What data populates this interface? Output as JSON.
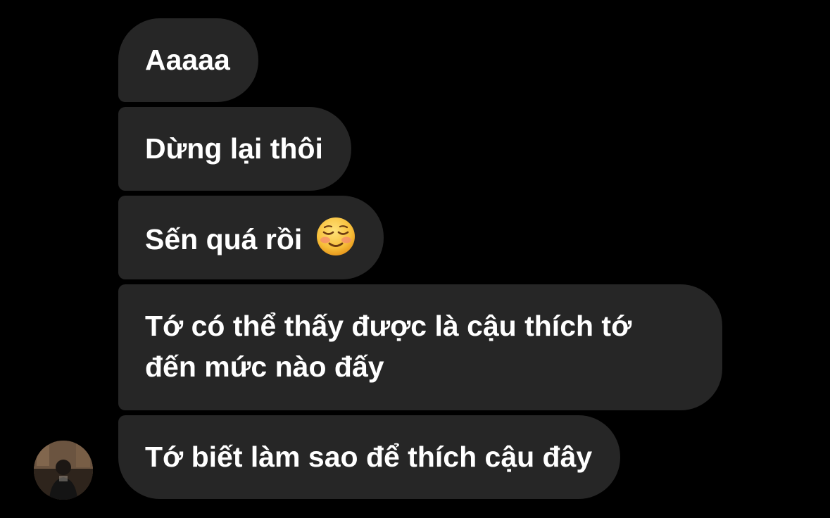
{
  "conversation": {
    "messages": [
      {
        "text": "Aaaaa"
      },
      {
        "text": "Dừng lại thôi"
      },
      {
        "text": "Sến quá rồi",
        "emoji": "smiling-face-with-blush-icon"
      },
      {
        "text": "Tớ có thể thấy được là cậu thích tớ đến mức nào đấy"
      },
      {
        "text": "Tớ biết làm sao để thích cậu đây"
      }
    ],
    "sender_avatar": "profile-photo-avatar"
  },
  "colors": {
    "background": "#000000",
    "bubble": "#262626",
    "text": "#ffffff"
  }
}
